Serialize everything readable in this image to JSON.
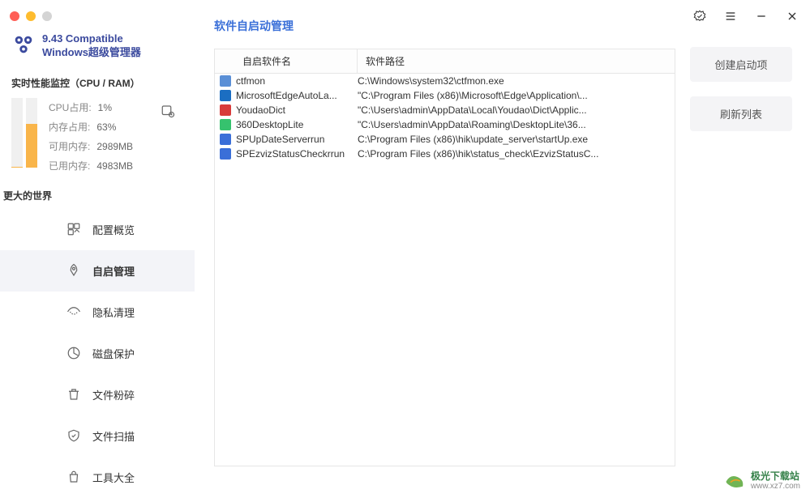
{
  "brand": {
    "line1": "9.43 Compatible",
    "line2": "Windows超级管理器"
  },
  "monitor": {
    "title": "实时性能监控（CPU / RAM）",
    "cpu_label": "CPU占用:",
    "cpu_value": "1%",
    "ram_label": "内存占用:",
    "ram_value": "63%",
    "avail_label": "可用内存:",
    "avail_value": "2989MB",
    "used_label": "已用内存:",
    "used_value": "4983MB"
  },
  "world_head": "更大的世界",
  "nav": {
    "items": [
      {
        "label": "配置概览",
        "icon": "dashboard-icon"
      },
      {
        "label": "自启管理",
        "icon": "rocket-icon"
      },
      {
        "label": "隐私清理",
        "icon": "eye-icon"
      },
      {
        "label": "磁盘保护",
        "icon": "pie-icon"
      },
      {
        "label": "文件粉碎",
        "icon": "trash-icon"
      },
      {
        "label": "文件扫描",
        "icon": "shield-icon"
      },
      {
        "label": "工具大全",
        "icon": "bag-icon"
      }
    ],
    "active_index": 1
  },
  "main": {
    "title": "软件自启动管理",
    "columns": {
      "c1": "自启软件名",
      "c2": "软件路径"
    },
    "rows": [
      {
        "icon_color": "#5a8fd6",
        "name": "ctfmon",
        "path": "C:\\Windows\\system32\\ctfmon.exe"
      },
      {
        "icon_color": "#1b6ec2",
        "name": "MicrosoftEdgeAutoLa...",
        "path": "\"C:\\Program Files (x86)\\Microsoft\\Edge\\Application\\..."
      },
      {
        "icon_color": "#d83b3b",
        "name": "YoudaoDict",
        "path": "\"C:\\Users\\admin\\AppData\\Local\\Youdao\\Dict\\Applic..."
      },
      {
        "icon_color": "#36c26e",
        "name": "360DesktopLite",
        "path": "\"C:\\Users\\admin\\AppData\\Roaming\\DesktopLite\\36..."
      },
      {
        "icon_color": "#3a6fd8",
        "name": "SPUpDateServerrun",
        "path": "C:\\Program Files (x86)\\hik\\update_server\\startUp.exe"
      },
      {
        "icon_color": "#3a6fd8",
        "name": "SPEzvizStatusCheckrrun",
        "path": "C:\\Program Files (x86)\\hik\\status_check\\EzvizStatusC..."
      }
    ]
  },
  "actions": {
    "create": "创建启动项",
    "refresh": "刷新列表"
  },
  "watermark": {
    "cn": "极光下载站",
    "url": "www.xz7.com"
  }
}
